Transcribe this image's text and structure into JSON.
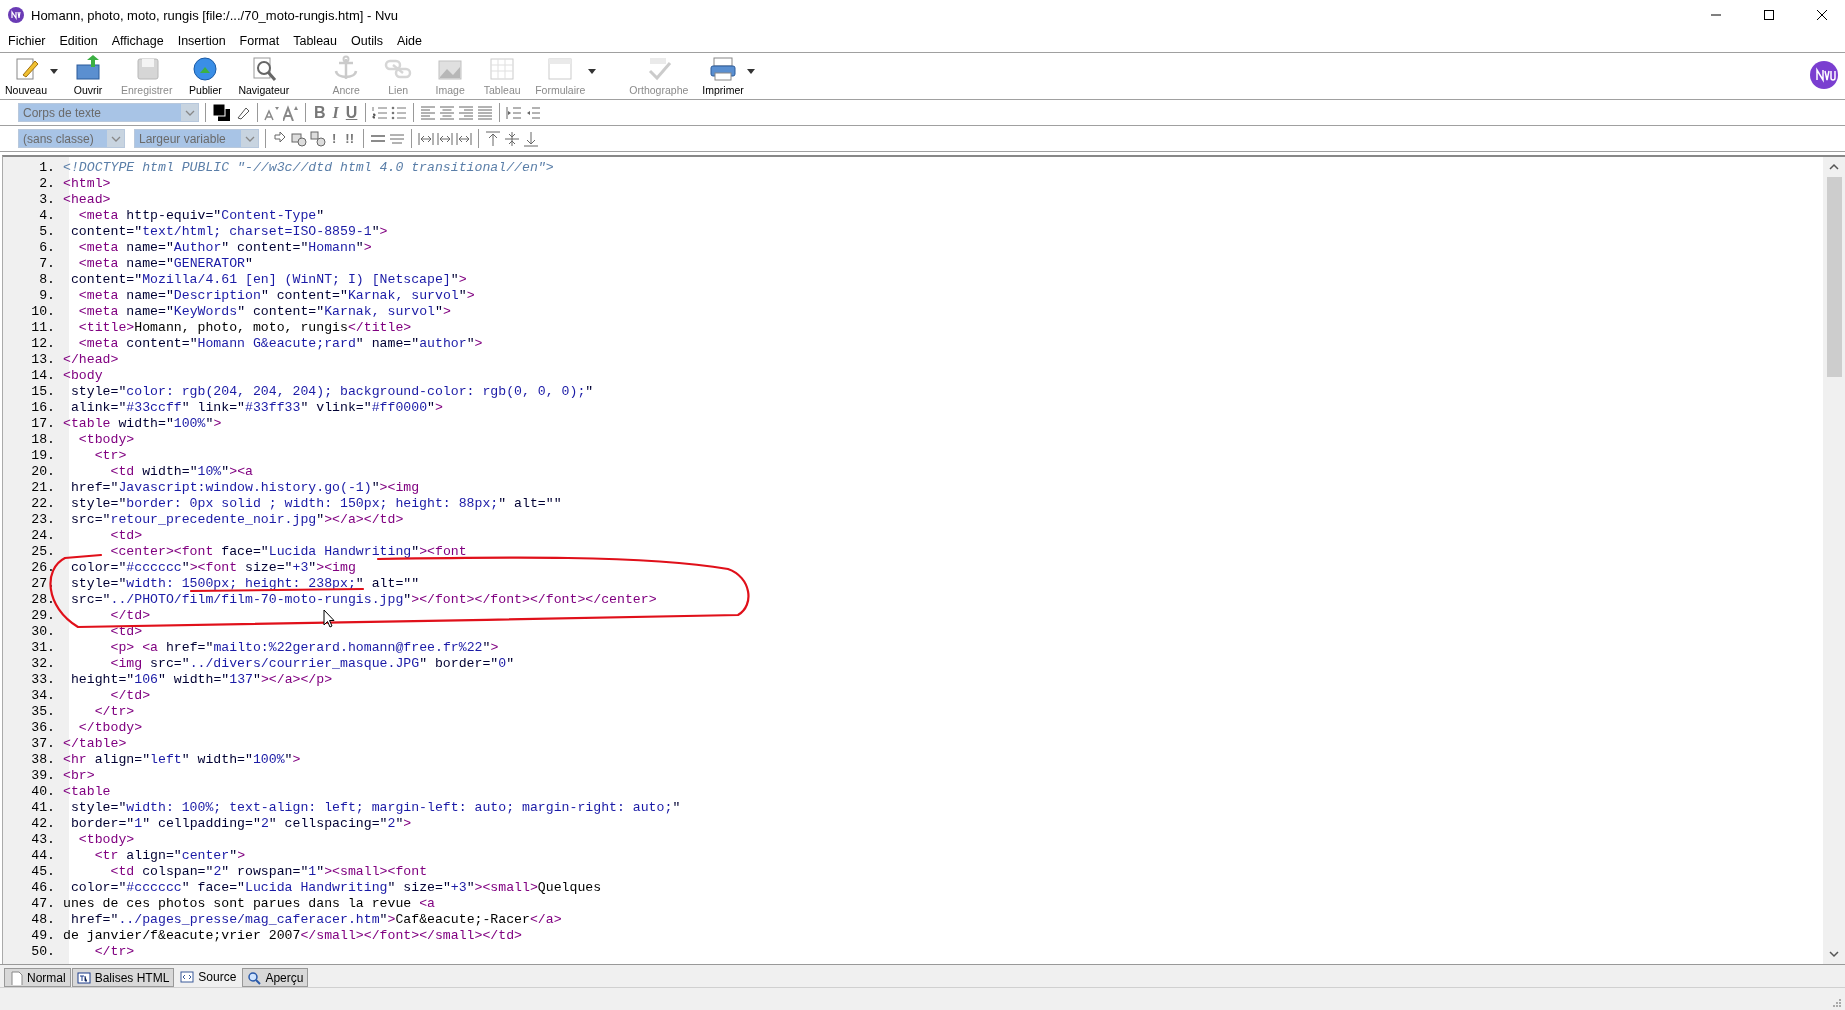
{
  "window": {
    "title": "Homann, photo, moto, rungis [file:/.../70_moto-rungis.htm] - Nvu"
  },
  "menu": [
    "Fichier",
    "Edition",
    "Affichage",
    "Insertion",
    "Format",
    "Tableau",
    "Outils",
    "Aide"
  ],
  "toolbar": [
    {
      "label": "Nouveau",
      "disabled": false,
      "dropdown": true
    },
    {
      "label": "Ouvrir",
      "disabled": false,
      "dropdown": false
    },
    {
      "label": "Enregistrer",
      "disabled": true,
      "dropdown": false
    },
    {
      "label": "Publier",
      "disabled": false,
      "dropdown": false
    },
    {
      "label": "Navigateur",
      "disabled": false,
      "dropdown": false
    },
    {
      "label": "Ancre",
      "disabled": true,
      "dropdown": false
    },
    {
      "label": "Lien",
      "disabled": true,
      "dropdown": false
    },
    {
      "label": "Image",
      "disabled": true,
      "dropdown": false
    },
    {
      "label": "Tableau",
      "disabled": true,
      "dropdown": false
    },
    {
      "label": "Formulaire",
      "disabled": true,
      "dropdown": true
    },
    {
      "label": "Orthographe",
      "disabled": true,
      "dropdown": false
    },
    {
      "label": "Imprimer",
      "disabled": false,
      "dropdown": true
    }
  ],
  "format_bar": {
    "paragraph_style": "Corps de texte",
    "bold": "B",
    "italic": "I",
    "underline": "U"
  },
  "format_bar_2": {
    "class": "(sans classe)",
    "font_width": "Largeur variable",
    "mark_1": "!",
    "mark_2": "!!"
  },
  "editor": {
    "lines": [
      {
        "n": "1.",
        "code": "<!DOCTYPE html PUBLIC \"-//w3c//dtd html 4.0 transitional//en\">"
      },
      {
        "n": "2.",
        "code": "<html>"
      },
      {
        "n": "3.",
        "code": "<head>"
      },
      {
        "n": "4.",
        "code": "  <meta http-equiv=\"Content-Type\""
      },
      {
        "n": "5.",
        "code": " content=\"text/html; charset=ISO-8859-1\">"
      },
      {
        "n": "6.",
        "code": "  <meta name=\"Author\" content=\"Homann\">"
      },
      {
        "n": "7.",
        "code": "  <meta name=\"GENERATOR\""
      },
      {
        "n": "8.",
        "code": " content=\"Mozilla/4.61 [en] (WinNT; I) [Netscape]\">"
      },
      {
        "n": "9.",
        "code": "  <meta name=\"Description\" content=\"Karnak, survol\">"
      },
      {
        "n": "10.",
        "code": "  <meta name=\"KeyWords\" content=\"Karnak, survol\">"
      },
      {
        "n": "11.",
        "code": "  <title>Homann, photo, moto, rungis</title>"
      },
      {
        "n": "12.",
        "code": "  <meta content=\"Homann G&eacute;rard\" name=\"author\">"
      },
      {
        "n": "13.",
        "code": "</head>"
      },
      {
        "n": "14.",
        "code": "<body"
      },
      {
        "n": "15.",
        "code": " style=\"color: rgb(204, 204, 204); background-color: rgb(0, 0, 0);\""
      },
      {
        "n": "16.",
        "code": " alink=\"#33ccff\" link=\"#33ff33\" vlink=\"#ff0000\">"
      },
      {
        "n": "17.",
        "code": "<table width=\"100%\">"
      },
      {
        "n": "18.",
        "code": "  <tbody>"
      },
      {
        "n": "19.",
        "code": "    <tr>"
      },
      {
        "n": "20.",
        "code": "      <td width=\"10%\"><a"
      },
      {
        "n": "21.",
        "code": " href=\"Javascript:window.history.go(-1)\"><img"
      },
      {
        "n": "22.",
        "code": " style=\"border: 0px solid ; width: 150px; height: 88px;\" alt=\"\""
      },
      {
        "n": "23.",
        "code": " src=\"retour_precedente_noir.jpg\"></a></td>"
      },
      {
        "n": "24.",
        "code": "      <td>"
      },
      {
        "n": "25.",
        "code": "      <center><font face=\"Lucida Handwriting\"><font"
      },
      {
        "n": "26.",
        "code": " color=\"#cccccc\"><font size=\"+3\"><img"
      },
      {
        "n": "27.",
        "code": " style=\"width: 1500px; height: 238px;\" alt=\"\""
      },
      {
        "n": "28.",
        "code": " src=\"../PHOTO/film/film-70-moto-rungis.jpg\"></font></font></font></center>"
      },
      {
        "n": "29.",
        "code": "      </td>"
      },
      {
        "n": "30.",
        "code": "      <td>"
      },
      {
        "n": "31.",
        "code": "      <p> <a href=\"mailto:%22gerard.homann@free.fr%22\">"
      },
      {
        "n": "32.",
        "code": "      <img src=\"../divers/courrier_masque.JPG\" border=\"0\""
      },
      {
        "n": "33.",
        "code": " height=\"106\" width=\"137\"></a></p>"
      },
      {
        "n": "34.",
        "code": "      </td>"
      },
      {
        "n": "35.",
        "code": "    </tr>"
      },
      {
        "n": "36.",
        "code": "  </tbody>"
      },
      {
        "n": "37.",
        "code": "</table>"
      },
      {
        "n": "38.",
        "code": "<hr align=\"left\" width=\"100%\">"
      },
      {
        "n": "39.",
        "code": "<br>"
      },
      {
        "n": "40.",
        "code": "<table"
      },
      {
        "n": "41.",
        "code": " style=\"width: 100%; text-align: left; margin-left: auto; margin-right: auto;\""
      },
      {
        "n": "42.",
        "code": " border=\"1\" cellpadding=\"2\" cellspacing=\"2\">"
      },
      {
        "n": "43.",
        "code": "  <tbody>"
      },
      {
        "n": "44.",
        "code": "    <tr align=\"center\">"
      },
      {
        "n": "45.",
        "code": "      <td colspan=\"2\" rowspan=\"1\"><small><font"
      },
      {
        "n": "46.",
        "code": " color=\"#cccccc\" face=\"Lucida Handwriting\" size=\"+3\"><small>Quelques"
      },
      {
        "n": "47.",
        "code": "unes de ces photos sont parues dans la revue <a"
      },
      {
        "n": "48.",
        "code": " href=\"../pages_presse/mag_caferacer.htm\">Caf&eacute;-Racer</a>"
      },
      {
        "n": "49.",
        "code": "de janvier/f&eacute;vrier 2007</small></font></small></td>"
      },
      {
        "n": "50.",
        "code": "    </tr>"
      }
    ]
  },
  "view_tabs": [
    {
      "label": "Normal",
      "selected": false
    },
    {
      "label": "Balises HTML",
      "selected": false
    },
    {
      "label": "Source",
      "selected": true
    },
    {
      "label": "Aperçu",
      "selected": false
    }
  ]
}
